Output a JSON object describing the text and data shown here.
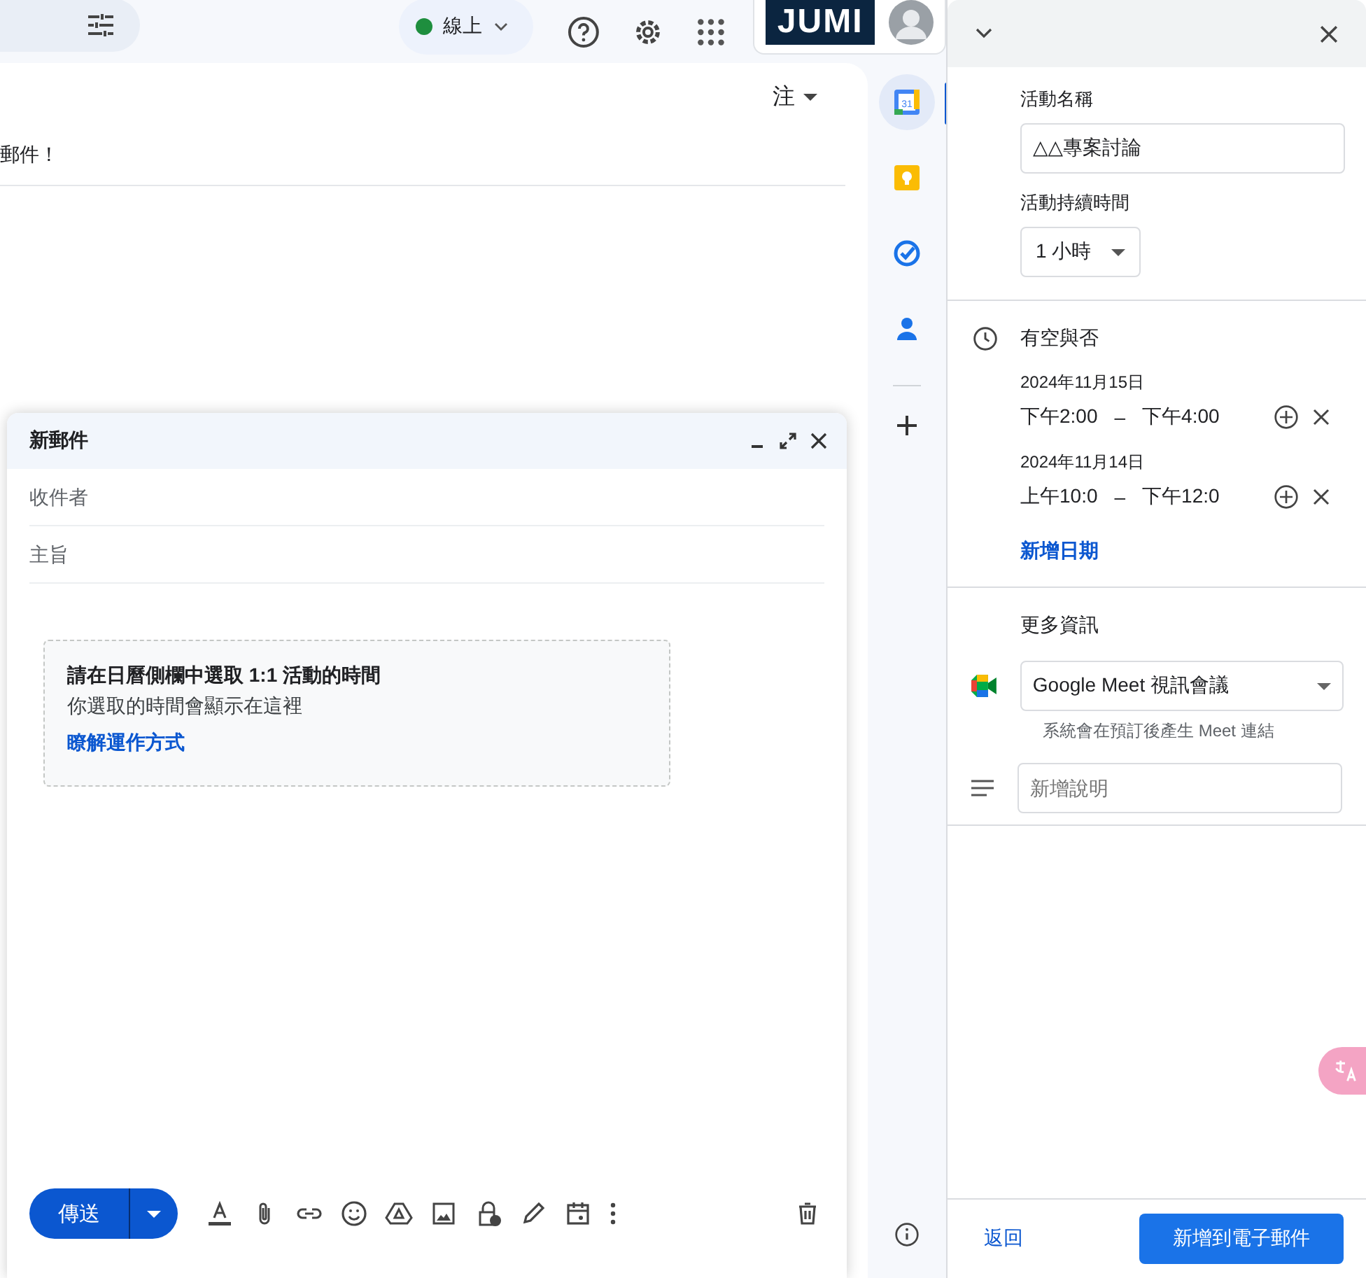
{
  "top_bar": {
    "status": {
      "label": "線上",
      "online": true
    },
    "logo": "JUMI"
  },
  "mail": {
    "sort_label": "注",
    "text_fragment": "郵件！"
  },
  "compose": {
    "title": "新郵件",
    "to_placeholder": "收件者",
    "subject_placeholder": "主旨",
    "info_card": {
      "title": "請在日曆側欄中選取 1:1 活動的時間",
      "body": "你選取的時間會顯示在這裡",
      "link": "瞭解運作方式"
    },
    "send_label": "傳送"
  },
  "side_apps": [
    {
      "kind": "calendar",
      "label": "31",
      "selected": true
    },
    {
      "kind": "keep",
      "selected": false
    },
    {
      "kind": "tasks",
      "selected": false
    },
    {
      "kind": "contacts",
      "selected": false
    }
  ],
  "event_panel": {
    "name_label": "活動名稱",
    "name_value": "△△專案討論",
    "duration_label": "活動持續時間",
    "duration_value": "1 小時",
    "availability_title": "有空與否",
    "slots": [
      {
        "date": "2024年11月15日",
        "start": "下午2:00",
        "dash": "–",
        "end": "下午4:00"
      },
      {
        "date": "2024年11月14日",
        "start": "上午10:0",
        "dash": "–",
        "end": "下午12:0"
      }
    ],
    "add_date": "新增日期",
    "more_title": "更多資訊",
    "meet_value": "Google Meet 視訊會議",
    "meet_hint": "系統會在預訂後產生 Meet 連結",
    "description_placeholder": "新增說明",
    "back": "返回",
    "submit": "新增到電子郵件"
  }
}
